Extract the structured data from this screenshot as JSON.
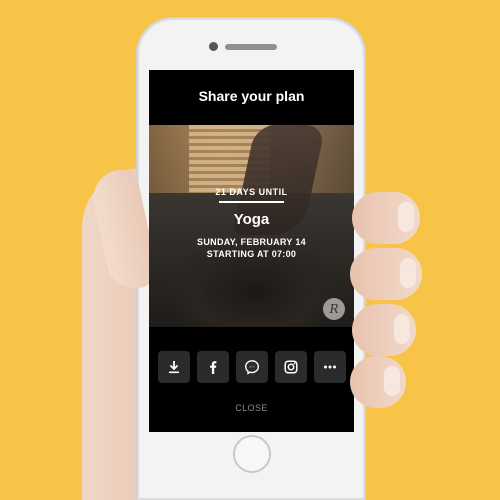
{
  "screen": {
    "title": "Share your plan",
    "countdown": "21 DAYS UNTIL",
    "activity": "Yoga",
    "date": "SUNDAY, FEBRUARY 14",
    "time": "STARTING AT 07:00",
    "brand_mark": "R"
  },
  "share_buttons": [
    {
      "name": "download",
      "icon": "download-icon"
    },
    {
      "name": "facebook",
      "icon": "facebook-icon"
    },
    {
      "name": "messenger",
      "icon": "messenger-icon"
    },
    {
      "name": "instagram",
      "icon": "instagram-icon"
    },
    {
      "name": "more",
      "icon": "more-icon"
    }
  ],
  "close_label": "CLOSE",
  "colors": {
    "background": "#F7C447",
    "screen": "#000000",
    "button": "#2B2B2B",
    "close_text": "#8A8A8A"
  }
}
